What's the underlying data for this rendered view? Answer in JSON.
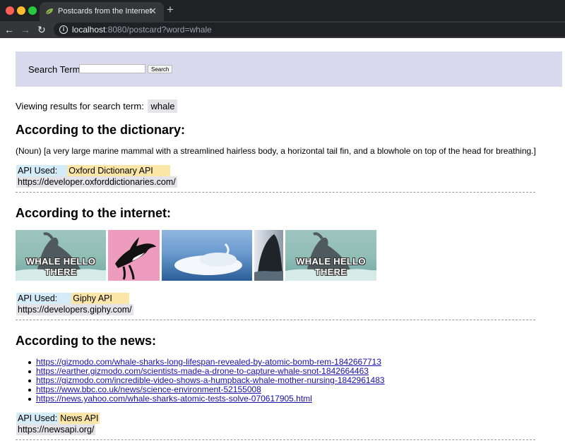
{
  "browser": {
    "tab_title": "Postcards from the Internet",
    "url_host": "localhost",
    "url_rest": ":8080/postcard?word=whale"
  },
  "search": {
    "label": "Search Term:",
    "value": "",
    "button_label": "Search"
  },
  "viewing": {
    "prefix": "Viewing results for search term:",
    "term": "whale"
  },
  "dictionary": {
    "heading": "According to the dictionary:",
    "definition": "(Noun) [a very large marine mammal with a streamlined hairless body, a horizontal tail fin, and a blowhole on top of the head for breathing.]",
    "api_used_label": "API Used:",
    "api_name": "Oxford Dictionary API",
    "api_url": "https://developer.oxforddictionaries.com/"
  },
  "internet": {
    "heading": "According to the internet:",
    "gif_captions": [
      "WHALE HELLO THERE",
      "WHALE HELLO THERE"
    ],
    "api_used_label": "API Used:",
    "api_name": "Giphy API",
    "api_url": "https://developers.giphy.com/"
  },
  "news": {
    "heading": "According to the news:",
    "links": [
      "https://gizmodo.com/whale-sharks-long-lifespan-revealed-by-atomic-bomb-rem-1842667713",
      "https://earther.gizmodo.com/scientists-made-a-drone-to-capture-whale-snot-1842664463",
      "https://gizmodo.com/incredible-video-shows-a-humpback-whale-mother-nursing-1842961483",
      "https://www.bbc.co.uk/news/science-environment-52155008",
      "https://news.yahoo.com/whale-sharks-atomic-tests-solve-070617905.html"
    ],
    "api_used_label": "API Used:",
    "api_name": "News API",
    "api_url": "https://newsapi.org/"
  }
}
